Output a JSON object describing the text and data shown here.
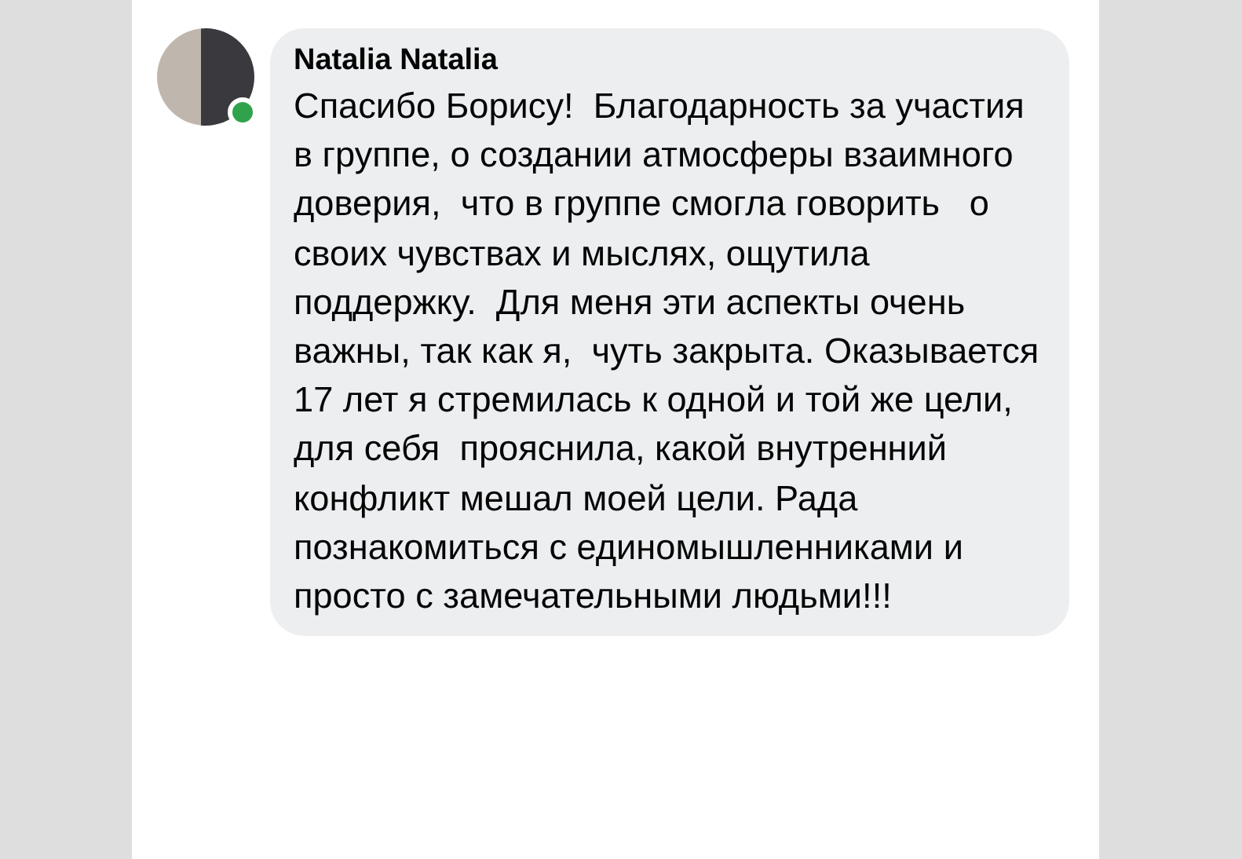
{
  "comment": {
    "author": "Natalia Natalia",
    "online": true,
    "text": "Спасибо Борису!  Благодарность за участия в группе, о создании атмосферы взаимного доверия,  что в группе смогла говорить   о своих чувствах и мыслях, ощутила поддержку.  Для меня эти аспекты очень важны, так как я,  чуть закрыта. Оказывается 17 лет я стремилась к одной и той же цели, для себя  прояснила, какой внутренний  конфликт мешал моей цели. Рада познакомиться с единомышленниками и просто с замечательными людьми!!!"
  }
}
